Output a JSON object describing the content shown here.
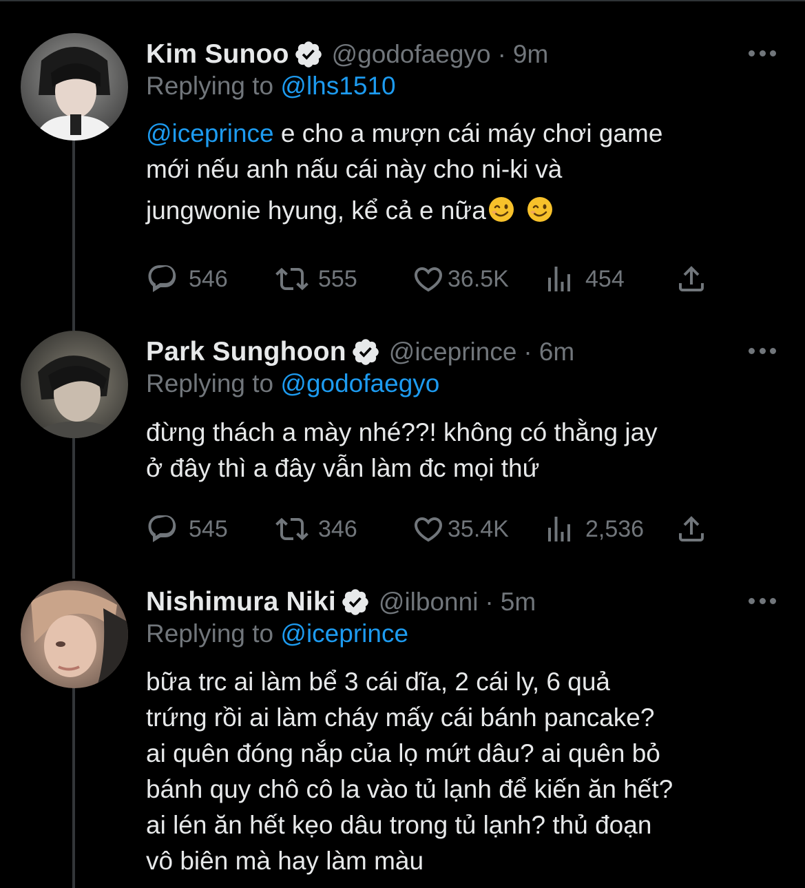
{
  "tweets": [
    {
      "name": "Kim Sunoo",
      "handle": "@godofaegyo",
      "separator": "·",
      "time": "9m",
      "replying_prefix": "Replying to ",
      "replying_to": "@lhs1510",
      "body_lines": [
        {
          "mention": "@iceprince",
          "text": " e cho a mượn cái máy chơi game"
        },
        {
          "text": "mới nếu anh nấu cái này cho ni-ki và"
        },
        {
          "text": "jungwonie hyung, kể cả e nữa",
          "emojis": [
            "winking-face",
            "winking-face"
          ]
        }
      ],
      "stats": {
        "replies": "546",
        "retweets": "555",
        "likes": "36.5K",
        "views": "454"
      }
    },
    {
      "name": "Park Sunghoon",
      "handle": "@iceprince",
      "separator": "·",
      "time": "6m",
      "replying_prefix": "Replying to ",
      "replying_to": "@godofaegyo",
      "body_lines": [
        {
          "text": "đừng thách a mày nhé??! không có thằng jay"
        },
        {
          "text": "ở đây thì a đây vẫn làm đc mọi thứ"
        }
      ],
      "stats": {
        "replies": "545",
        "retweets": "346",
        "likes": "35.4K",
        "views": "2,536"
      }
    },
    {
      "name": "Nishimura Niki",
      "handle": "@ilbonni",
      "separator": "·",
      "time": "5m",
      "replying_prefix": "Replying to ",
      "replying_to": "@iceprince",
      "body_lines": [
        {
          "text": "bữa trc ai làm bể 3 cái dĩa, 2 cái ly, 6 quả"
        },
        {
          "text": "trứng rồi ai làm cháy mấy cái bánh pancake?"
        },
        {
          "text": "ai quên đóng nắp của lọ mứt dâu? ai quên bỏ"
        },
        {
          "text": "bánh quy chô cô la vào tủ lạnh để kiến ăn hết?"
        },
        {
          "text": "ai lén ăn hết kẹo dâu trong tủ lạnh? thủ đoạn"
        },
        {
          "text": "vô biên mà hay làm màu"
        }
      ]
    }
  ],
  "icons": {
    "reply": "reply-icon",
    "retweet": "retweet-icon",
    "like": "heart-icon",
    "views": "views-icon",
    "share": "share-icon",
    "verified": "verified-badge-icon",
    "more": "more-options-icon"
  },
  "colors": {
    "background": "#000000",
    "text": "#e7e9ea",
    "secondary": "#71767b",
    "link": "#1d9bf0",
    "thread_line": "#333639"
  }
}
